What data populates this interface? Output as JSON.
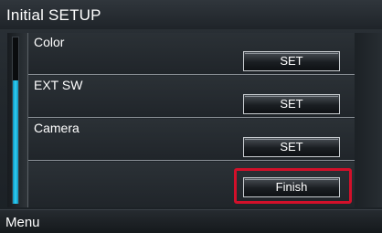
{
  "header": {
    "title": "Initial SETUP"
  },
  "rows": [
    {
      "label": "Color",
      "button": "SET"
    },
    {
      "label": "EXT SW",
      "button": "SET"
    },
    {
      "label": "Camera",
      "button": "SET"
    },
    {
      "label": "",
      "button": "Finish"
    }
  ],
  "footer": {
    "menu_label": "Menu"
  },
  "colors": {
    "highlight": "#d2102a",
    "scroll_accent": "#2fd1f6"
  }
}
